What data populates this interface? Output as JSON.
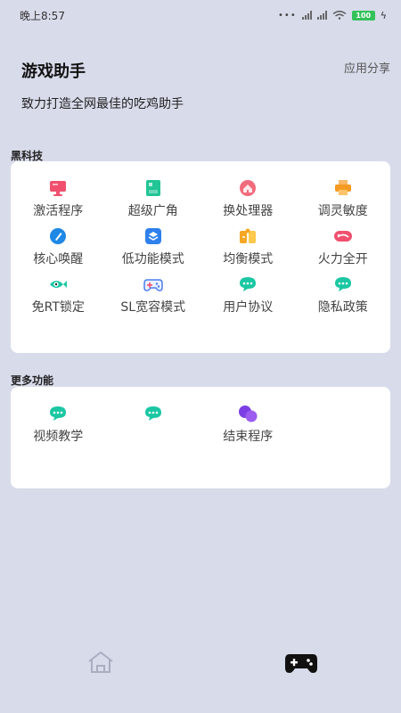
{
  "status_bar": {
    "time": "晚上8:57",
    "battery": "100"
  },
  "header": {
    "title": "游戏助手",
    "share_label": "应用分享",
    "subtitle": "致力打造全网最佳的吃鸡助手"
  },
  "black_tech": {
    "section_title": "黑科技",
    "items": [
      {
        "label": "激活程序",
        "icon": "monitor-icon",
        "color": "#f0506e"
      },
      {
        "label": "超级广角",
        "icon": "image-icon",
        "color": "#21c596"
      },
      {
        "label": "换处理器",
        "icon": "house-icon",
        "color": "#f26b7c"
      },
      {
        "label": "调灵敏度",
        "icon": "printer-icon",
        "color": "#f59a23"
      },
      {
        "label": "核心唤醒",
        "icon": "pen-icon",
        "color": "#1e88e5"
      },
      {
        "label": "低功能模式",
        "icon": "layers-icon",
        "color": "#2f80ed"
      },
      {
        "label": "均衡模式",
        "icon": "puzzle-icon",
        "color": "#f5a623"
      },
      {
        "label": "火力全开",
        "icon": "car-icon",
        "color": "#f0506e"
      },
      {
        "label": "免RT锁定",
        "icon": "fish-icon",
        "color": "#1bc7a3"
      },
      {
        "label": "SL宽容模式",
        "icon": "gamepad-icon",
        "color": "#4a7df0"
      },
      {
        "label": "用户协议",
        "icon": "chat-icon",
        "color": "#1bc7a3"
      },
      {
        "label": "隐私政策",
        "icon": "chat-icon",
        "color": "#1bc7a3"
      }
    ]
  },
  "more_features": {
    "section_title": "更多功能",
    "items": [
      {
        "label": "视频教学",
        "icon": "chat-icon",
        "color": "#1bc7a3"
      },
      {
        "label": "",
        "icon": "chat-icon",
        "color": "#1bc7a3"
      },
      {
        "label": "结束程序",
        "icon": "bubbles-icon",
        "color": "#7b3fe4"
      }
    ]
  },
  "tab_bar": {
    "tabs": [
      {
        "name": "home",
        "icon": "home-icon",
        "active": false
      },
      {
        "name": "game",
        "icon": "gamepad-icon",
        "active": true
      }
    ]
  }
}
